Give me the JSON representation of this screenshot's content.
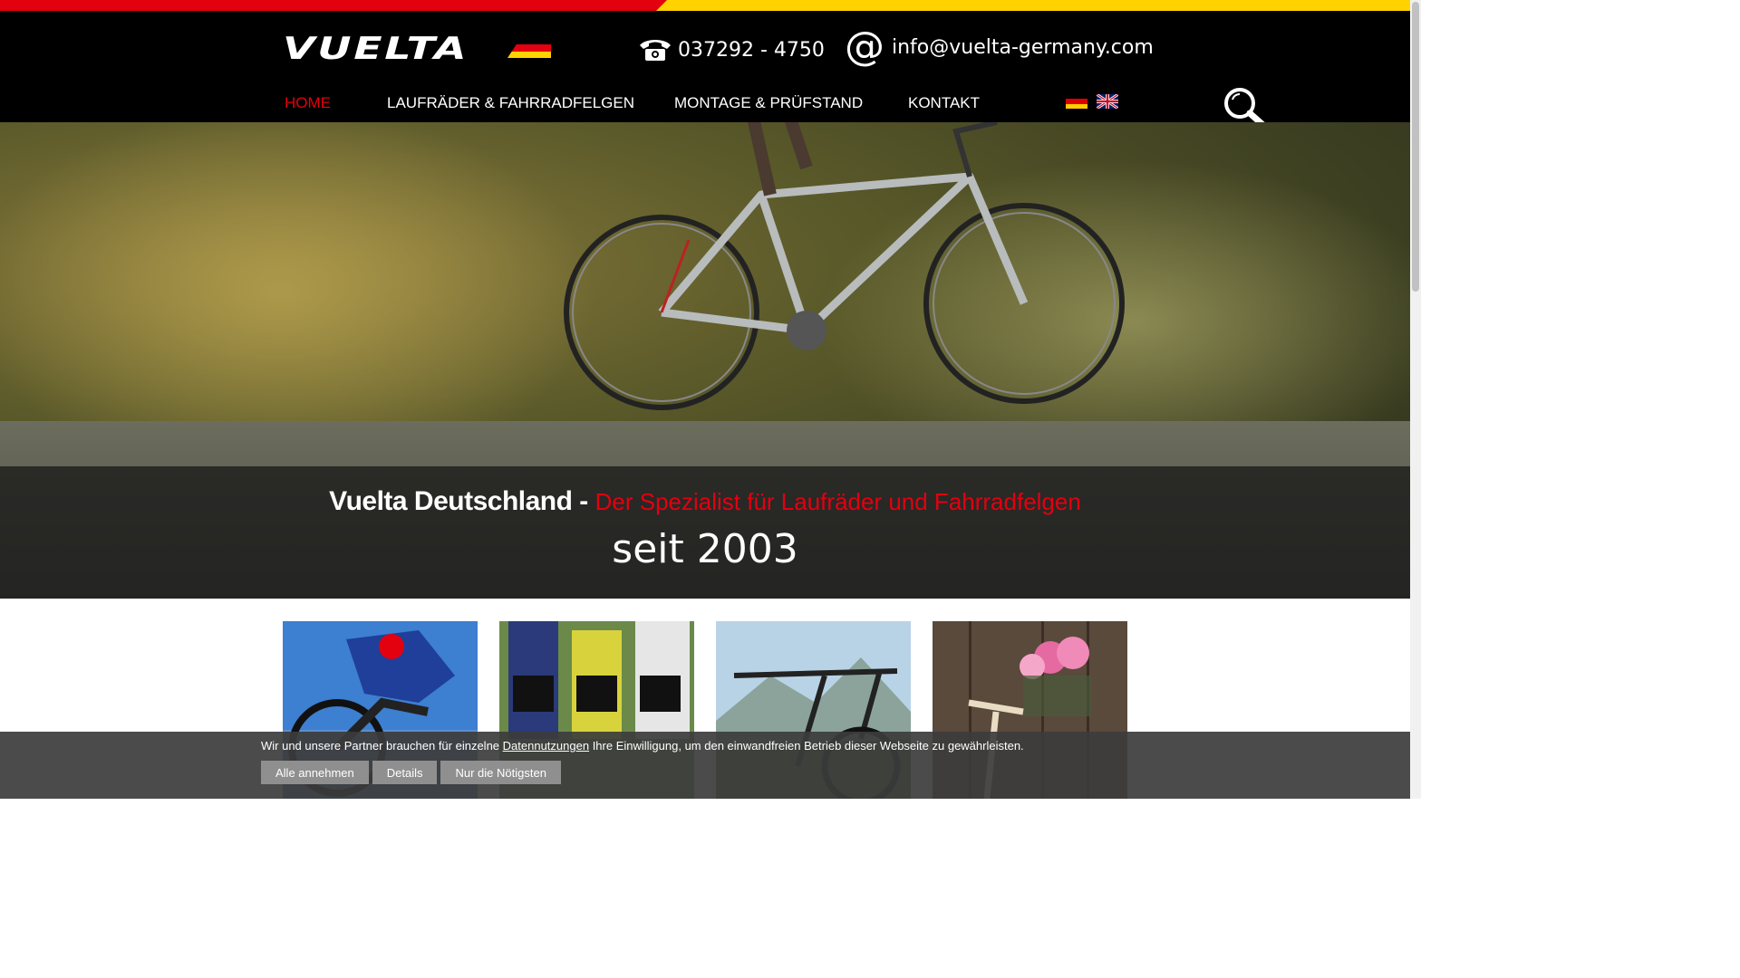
{
  "header": {
    "logo_text": "VUELTA",
    "phone": "037292 - 4750",
    "email": "info@vuelta-germany.com",
    "nav": [
      {
        "label": "HOME",
        "active": true
      },
      {
        "label": "LAUFRÄDER & FAHRRADFELGEN",
        "active": false
      },
      {
        "label": "MONTAGE & PRÜFSTAND",
        "active": false
      },
      {
        "label": "KONTAKT",
        "active": false
      }
    ],
    "languages": [
      "de-flag-icon",
      "uk-flag-icon"
    ],
    "search_icon": "search-icon"
  },
  "hero": {
    "title": "Vuelta Deutschland - ",
    "subtitle": "Der Spezialist für Laufräder und Fahrradfelgen",
    "since": "seit 2003"
  },
  "tiles": [
    "mountain-bike-image",
    "road-race-image",
    "e-bike-image",
    "city-bike-image"
  ],
  "cookie": {
    "text_before": "Wir und unsere Partner brauchen für einzelne ",
    "link": "Datennutzungen",
    "text_after": " Ihre Einwilligung, um den einwandfreien Betrieb dieser Webseite zu gewährleisten.",
    "buttons": [
      "Alle annehmen",
      "Details",
      "Nur die Nötigsten"
    ]
  },
  "colors": {
    "accent_red": "#e3000f",
    "accent_yellow": "#ffd200",
    "header_bg": "#000000"
  }
}
